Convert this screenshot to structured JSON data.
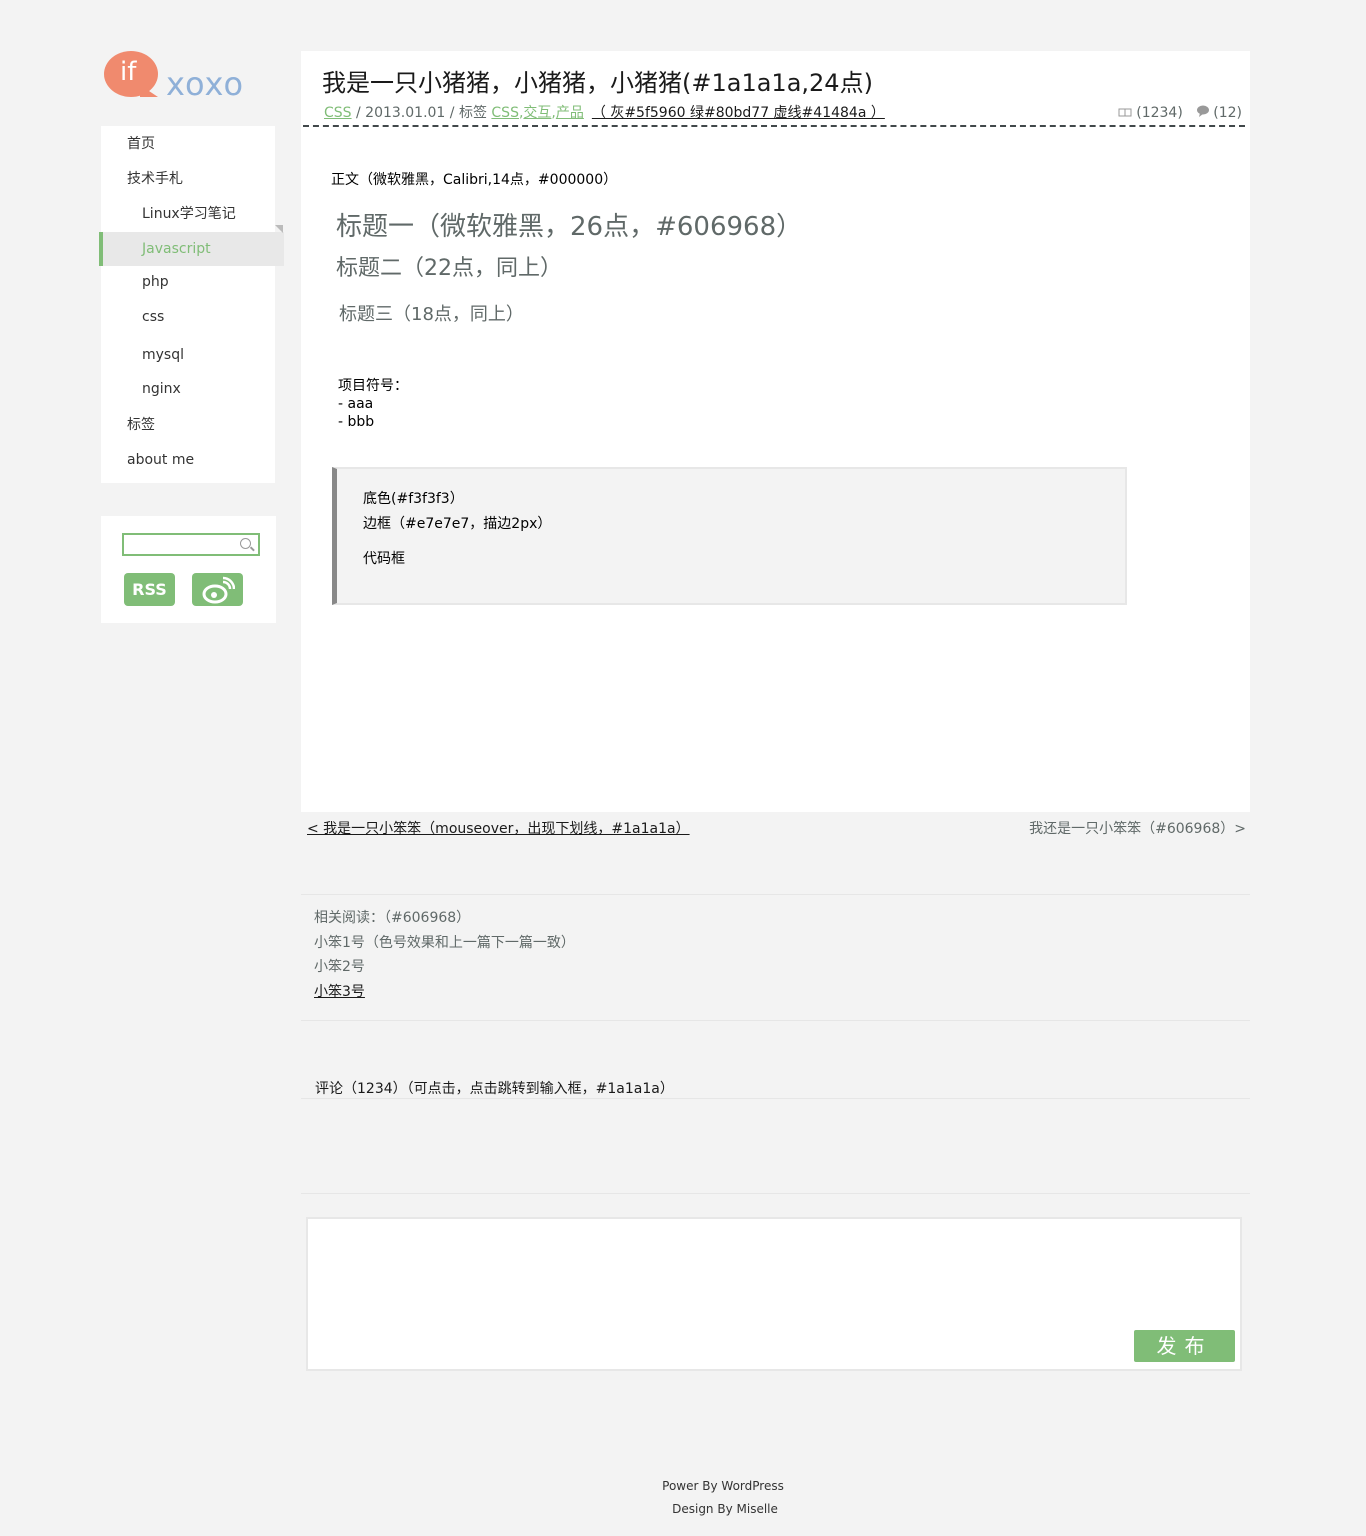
{
  "logo": {
    "text_if": "if",
    "text_xoxo": "xoxo"
  },
  "nav": {
    "items": [
      {
        "label": "首页"
      },
      {
        "label": "技术手札"
      },
      {
        "label": "Linux学习笔记"
      },
      {
        "label": "Javascript"
      },
      {
        "label": "php"
      },
      {
        "label": "css"
      },
      {
        "label": "mysql"
      },
      {
        "label": "nginx"
      },
      {
        "label": "标签"
      },
      {
        "label": "about me"
      }
    ]
  },
  "tools": {
    "rss_label": "RSS",
    "search_placeholder": ""
  },
  "post": {
    "title": "我是一只小猪猪，小猪猪，小猪猪(#1a1a1a,24点)",
    "category": "CSS",
    "date_sep": " / 2013.01.01 / 标签 ",
    "tag1": "CSS",
    "tag2": "交互",
    "tag3": "产品",
    "note": "（ 灰#5f5960 绿#80bd77 虚线#41484a ）",
    "views": "(1234)",
    "comments": "(12)",
    "intro": "正文（微软雅黑，Calibri,14点，#000000）",
    "h1": "标题一（微软雅黑，26点，#606968）",
    "h2": "标题二（22点，同上）",
    "h3": "标题三（18点，同上）",
    "list_title": "项目符号：",
    "list_items": [
      "- aaa",
      "- bbb"
    ],
    "code_lines": [
      "底色(#f3f3f3）",
      "边框（#e7e7e7，描边2px）",
      "代码框"
    ]
  },
  "pager": {
    "prev": "< 我是一只小笨笨（mouseover，出现下划线，#1a1a1a）",
    "next": "我还是一只小笨笨（#606968）>"
  },
  "related": {
    "heading": "相关阅读：（#606968）",
    "items": [
      "小笨1号（色号效果和上一篇下一篇一致）",
      "小笨2号",
      "小笨3号"
    ]
  },
  "comments": {
    "heading": "评论（1234）（可点击，点击跳转到输入框，#1a1a1a）",
    "publish_label": "发布"
  },
  "footer": {
    "line1": "Power By WordPress",
    "line2": "Design By Miselle"
  },
  "colors": {
    "green": "#80bd77",
    "gray": "#606968",
    "text": "#1a1a1a",
    "dash": "#41484a"
  }
}
